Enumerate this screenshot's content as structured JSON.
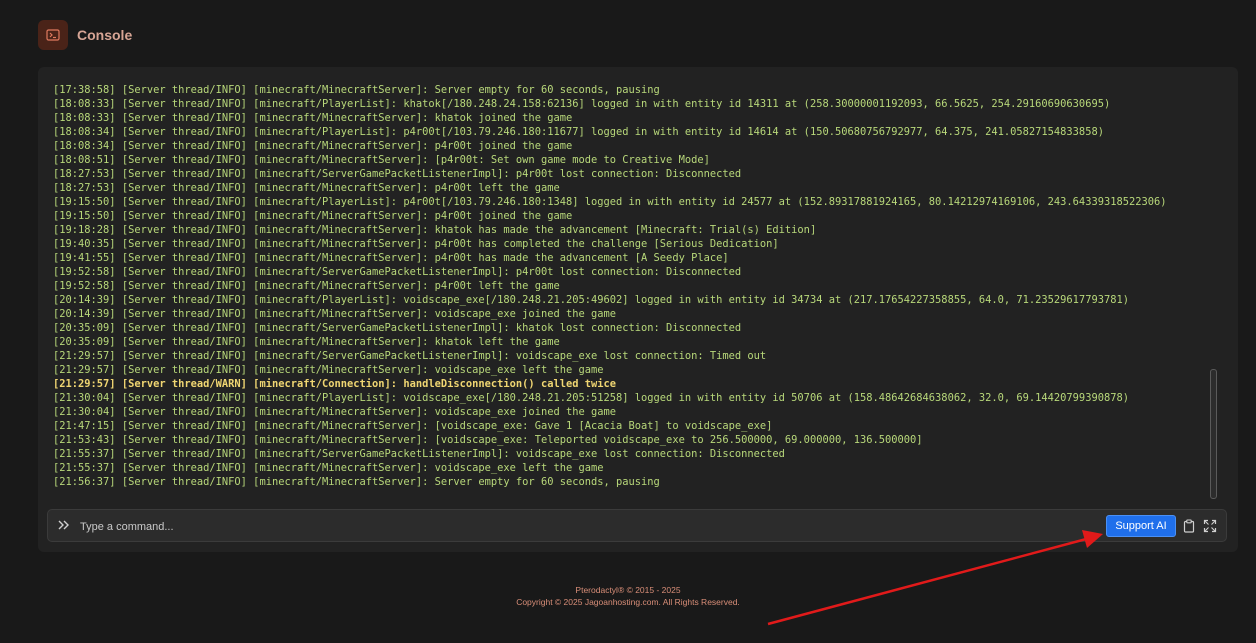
{
  "header": {
    "title": "Console",
    "icon": "terminal-icon",
    "accent": "#4a2318"
  },
  "log": {
    "lines": [
      {
        "text": "[17:38:58] [Server thread/INFO] [minecraft/MinecraftServer]: Server empty for 60 seconds, pausing",
        "level": "info"
      },
      {
        "text": "[18:08:33] [Server thread/INFO] [minecraft/PlayerList]: khatok[/180.248.24.158:62136] logged in with entity id 14311 at (258.30000001192093, 66.5625, 254.29160690630695)",
        "level": "info"
      },
      {
        "text": "[18:08:33] [Server thread/INFO] [minecraft/MinecraftServer]: khatok joined the game",
        "level": "info"
      },
      {
        "text": "[18:08:34] [Server thread/INFO] [minecraft/PlayerList]: p4r00t[/103.79.246.180:11677] logged in with entity id 14614 at (150.50680756792977, 64.375, 241.05827154833858)",
        "level": "info"
      },
      {
        "text": "[18:08:34] [Server thread/INFO] [minecraft/MinecraftServer]: p4r00t joined the game",
        "level": "info"
      },
      {
        "text": "[18:08:51] [Server thread/INFO] [minecraft/MinecraftServer]: [p4r00t: Set own game mode to Creative Mode]",
        "level": "info"
      },
      {
        "text": "[18:27:53] [Server thread/INFO] [minecraft/ServerGamePacketListenerImpl]: p4r00t lost connection: Disconnected",
        "level": "info"
      },
      {
        "text": "[18:27:53] [Server thread/INFO] [minecraft/MinecraftServer]: p4r00t left the game",
        "level": "info"
      },
      {
        "text": "[19:15:50] [Server thread/INFO] [minecraft/PlayerList]: p4r00t[/103.79.246.180:1348] logged in with entity id 24577 at (152.89317881924165, 80.14212974169106, 243.64339318522306)",
        "level": "info"
      },
      {
        "text": "[19:15:50] [Server thread/INFO] [minecraft/MinecraftServer]: p4r00t joined the game",
        "level": "info"
      },
      {
        "text": "[19:18:28] [Server thread/INFO] [minecraft/MinecraftServer]: khatok has made the advancement [Minecraft: Trial(s) Edition]",
        "level": "info"
      },
      {
        "text": "[19:40:35] [Server thread/INFO] [minecraft/MinecraftServer]: p4r00t has completed the challenge [Serious Dedication]",
        "level": "info"
      },
      {
        "text": "[19:41:55] [Server thread/INFO] [minecraft/MinecraftServer]: p4r00t has made the advancement [A Seedy Place]",
        "level": "info"
      },
      {
        "text": "[19:52:58] [Server thread/INFO] [minecraft/ServerGamePacketListenerImpl]: p4r00t lost connection: Disconnected",
        "level": "info"
      },
      {
        "text": "[19:52:58] [Server thread/INFO] [minecraft/MinecraftServer]: p4r00t left the game",
        "level": "info"
      },
      {
        "text": "[20:14:39] [Server thread/INFO] [minecraft/PlayerList]: voidscape_exe[/180.248.21.205:49602] logged in with entity id 34734 at (217.17654227358855, 64.0, 71.23529617793781)",
        "level": "info"
      },
      {
        "text": "[20:14:39] [Server thread/INFO] [minecraft/MinecraftServer]: voidscape_exe joined the game",
        "level": "info"
      },
      {
        "text": "[20:35:09] [Server thread/INFO] [minecraft/ServerGamePacketListenerImpl]: khatok lost connection: Disconnected",
        "level": "info"
      },
      {
        "text": "[20:35:09] [Server thread/INFO] [minecraft/MinecraftServer]: khatok left the game",
        "level": "info"
      },
      {
        "text": "[21:29:57] [Server thread/INFO] [minecraft/ServerGamePacketListenerImpl]: voidscape_exe lost connection: Timed out",
        "level": "info"
      },
      {
        "text": "[21:29:57] [Server thread/INFO] [minecraft/MinecraftServer]: voidscape_exe left the game",
        "level": "info"
      },
      {
        "text": "[21:29:57] [Server thread/WARN] [minecraft/Connection]: handleDisconnection() called twice",
        "level": "warn"
      },
      {
        "text": "[21:30:04] [Server thread/INFO] [minecraft/PlayerList]: voidscape_exe[/180.248.21.205:51258] logged in with entity id 50706 at (158.48642684638062, 32.0, 69.14420799390878)",
        "level": "info"
      },
      {
        "text": "[21:30:04] [Server thread/INFO] [minecraft/MinecraftServer]: voidscape_exe joined the game",
        "level": "info"
      },
      {
        "text": "[21:47:15] [Server thread/INFO] [minecraft/MinecraftServer]: [voidscape_exe: Gave 1 [Acacia Boat] to voidscape_exe]",
        "level": "info"
      },
      {
        "text": "[21:53:43] [Server thread/INFO] [minecraft/MinecraftServer]: [voidscape_exe: Teleported voidscape_exe to 256.500000, 69.000000, 136.500000]",
        "level": "info"
      },
      {
        "text": "[21:55:37] [Server thread/INFO] [minecraft/ServerGamePacketListenerImpl]: voidscape_exe lost connection: Disconnected",
        "level": "info"
      },
      {
        "text": "[21:55:37] [Server thread/INFO] [minecraft/MinecraftServer]: voidscape_exe left the game",
        "level": "info"
      },
      {
        "text": "[21:56:37] [Server thread/INFO] [minecraft/MinecraftServer]: Server empty for 60 seconds, pausing",
        "level": "info"
      }
    ],
    "info_color": "#b8d87a",
    "warn_color": "#f0d672"
  },
  "command": {
    "prompt_icon": "double-chevron-right-icon",
    "placeholder": "Type a command...",
    "value": "",
    "support_label": "Support AI",
    "support_color": "#1f6feb",
    "clipboard_icon": "clipboard-icon",
    "expand_icon": "expand-icon"
  },
  "footer": {
    "line1": "Pterodactyl® © 2015 - 2025",
    "line2": "Copyright © 2025 Jagoanhosting.com. All Rights Reserved."
  },
  "annotation": {
    "arrow_color": "#e11a1a",
    "arrow_icon": "red-arrow-icon"
  }
}
